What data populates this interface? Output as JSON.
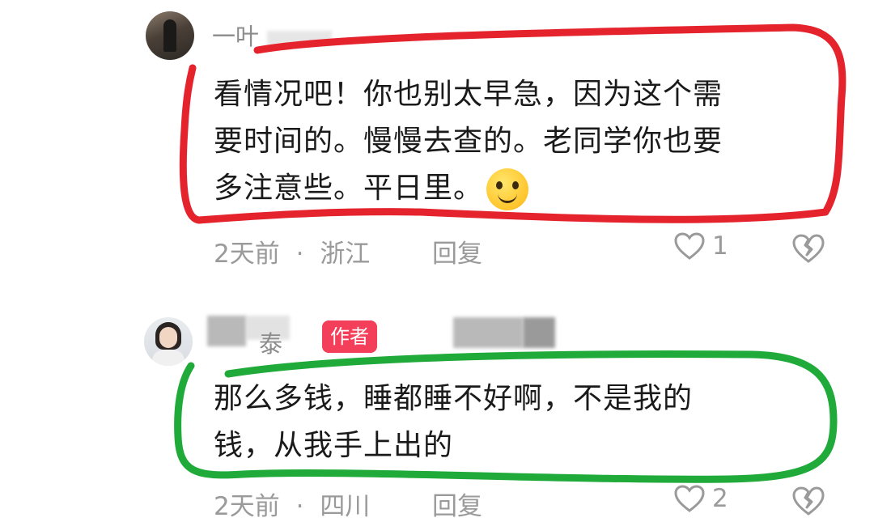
{
  "comments": [
    {
      "username": "一叶",
      "text_line1": "看情况吧！你也别太早急，因为这个需",
      "text_line2": "要时间的。慢慢去查的。老同学你也要",
      "text_line3": "多注意些。平日里。",
      "emoji_icon": "smiling-face-icon",
      "time": "2天前",
      "separator": "·",
      "location": "浙江",
      "reply_label": "回复",
      "like_count": "1",
      "highlight_color": "#e5232d"
    },
    {
      "username": "泰",
      "author_badge": "作者",
      "text_line1": "那么多钱，睡都睡不好啊，不是我的",
      "text_line2": "钱，从我手上出的",
      "time": "2天前",
      "separator": "·",
      "location": "四川",
      "reply_label": "回复",
      "like_count": "2",
      "highlight_color": "#1faa3a"
    }
  ],
  "colors": {
    "badge": "#f43f5a",
    "meta_text": "#9a9a9a"
  }
}
